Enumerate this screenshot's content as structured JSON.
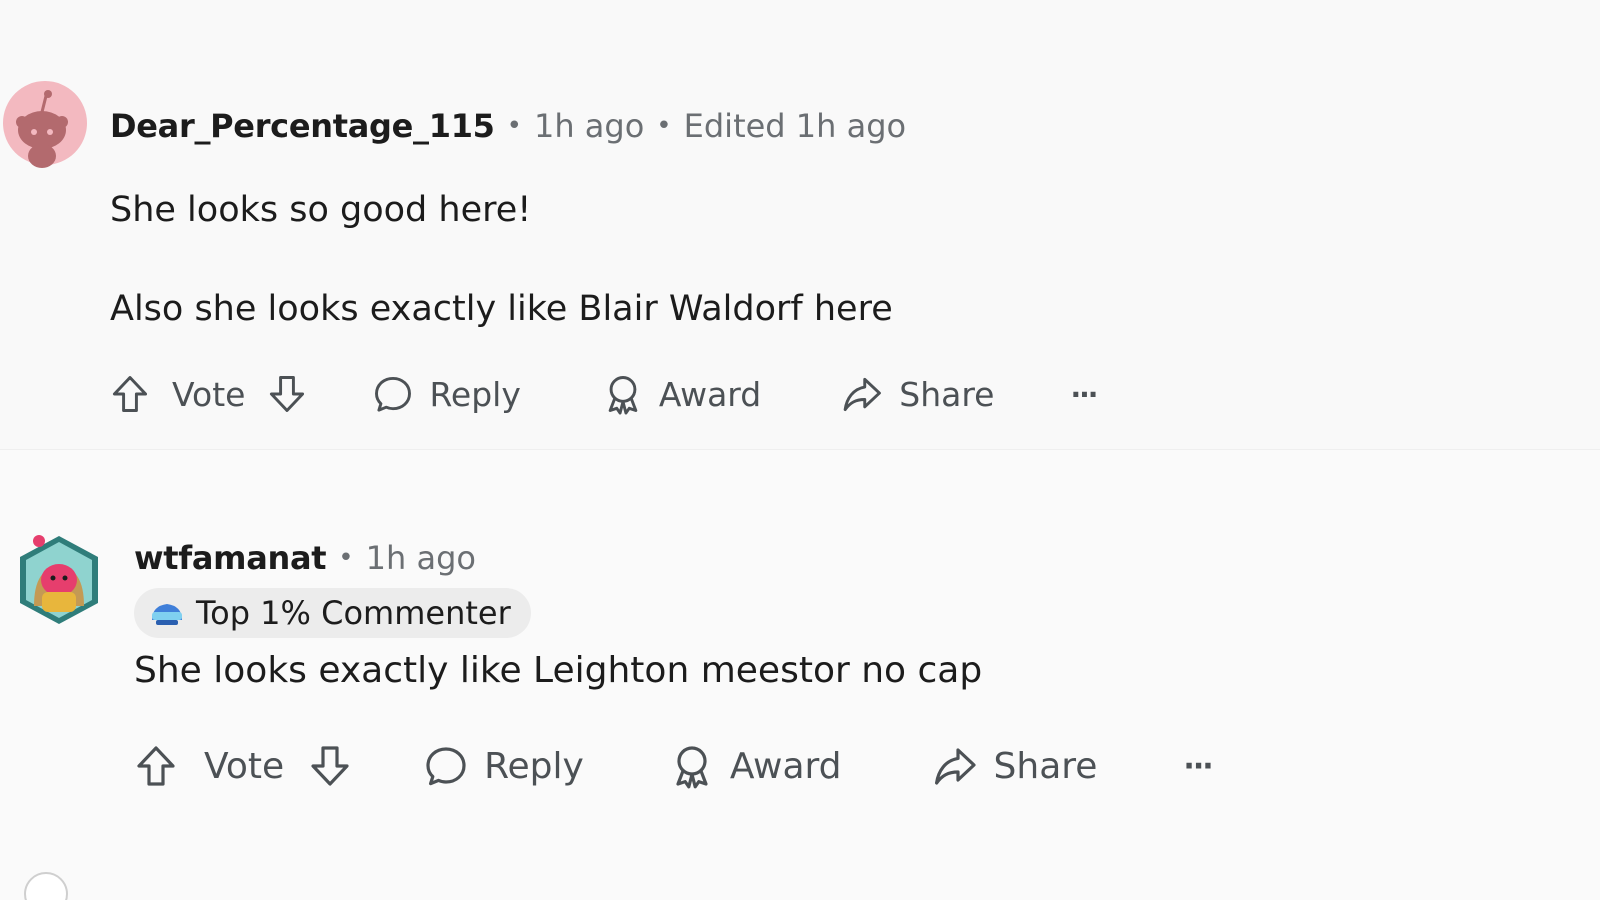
{
  "comments": [
    {
      "username": "Dear_Percentage_115",
      "time": "1h ago",
      "edited": "Edited 1h ago",
      "paragraphs": [
        "She looks so good here!",
        "Also she looks exactly like Blair Waldorf here"
      ],
      "actions": {
        "vote": "Vote",
        "reply": "Reply",
        "award": "Award",
        "share": "Share",
        "more": "···"
      }
    },
    {
      "username": "wtfamanat",
      "time": "1h ago",
      "flair": "Top 1% Commenter",
      "paragraphs": [
        "She looks exactly like Leighton meestor no cap"
      ],
      "actions": {
        "vote": "Vote",
        "reply": "Reply",
        "award": "Award",
        "share": "Share",
        "more": "···"
      }
    }
  ],
  "meta_separator": "•",
  "icons": {
    "upvote": "arrow-up-icon",
    "downvote": "arrow-down-icon",
    "reply": "speech-bubble-icon",
    "award": "award-ribbon-icon",
    "share": "share-arrow-icon",
    "more": "ellipsis-icon"
  },
  "colors": {
    "background": "#f9f9f9",
    "text_primary": "#1c1c1c",
    "text_meta": "#6b6f73",
    "action_text": "#4c5155",
    "avatar1_bg": "#f3b9c0",
    "flair_bg": "#ececec"
  }
}
